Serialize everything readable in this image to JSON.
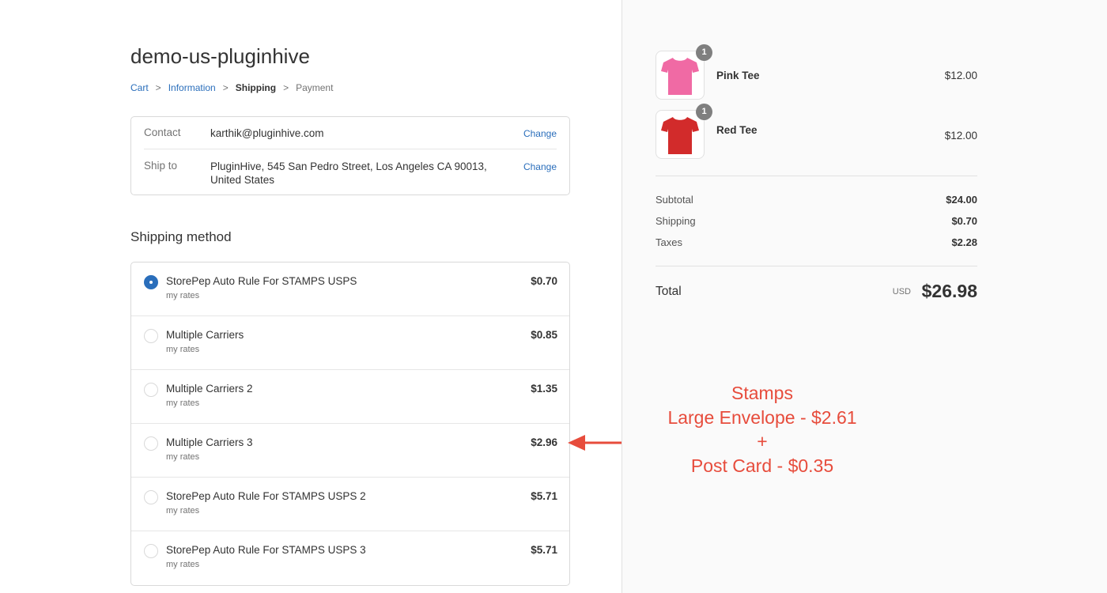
{
  "store": {
    "name": "demo-us-pluginhive"
  },
  "breadcrumb": {
    "items": [
      "Cart",
      "Information",
      "Shipping",
      "Payment"
    ],
    "separator": ">"
  },
  "review": {
    "contact": {
      "label": "Contact",
      "value": "karthik@pluginhive.com",
      "action": "Change"
    },
    "ship_to": {
      "label": "Ship to",
      "value": "PluginHive, 545 San Pedro Street, Los Angeles CA 90013, United States",
      "action": "Change"
    }
  },
  "shipping_method": {
    "title": "Shipping method",
    "options": [
      {
        "name": "StorePep Auto Rule For STAMPS USPS",
        "sub": "my rates",
        "price": "$0.70",
        "selected": true
      },
      {
        "name": "Multiple Carriers",
        "sub": "my rates",
        "price": "$0.85",
        "selected": false
      },
      {
        "name": "Multiple Carriers 2",
        "sub": "my rates",
        "price": "$1.35",
        "selected": false
      },
      {
        "name": "Multiple Carriers 3",
        "sub": "my rates",
        "price": "$2.96",
        "selected": false
      },
      {
        "name": "StorePep Auto Rule For STAMPS USPS 2",
        "sub": "my rates",
        "price": "$5.71",
        "selected": false
      },
      {
        "name": "StorePep Auto Rule For STAMPS USPS 3",
        "sub": "my rates",
        "price": "$5.71",
        "selected": false
      }
    ]
  },
  "order": {
    "items": [
      {
        "name": "Pink Tee",
        "price": "$12.00",
        "quantity": "1",
        "color": "#f06aa4",
        "icon": "tshirt-icon"
      },
      {
        "name": "Red Tee",
        "price": "$12.00",
        "quantity": "1",
        "color": "#d22b2b",
        "icon": "tshirt-icon"
      }
    ],
    "subtotal": {
      "label": "Subtotal",
      "value": "$24.00"
    },
    "shipping": {
      "label": "Shipping",
      "value": "$0.70"
    },
    "taxes": {
      "label": "Taxes",
      "value": "$2.28"
    },
    "total": {
      "label": "Total",
      "currency": "USD",
      "value": "$26.98"
    }
  },
  "annotation": {
    "lines": [
      "Stamps",
      "Large Envelope - $2.61",
      "+",
      "Post Card - $0.35"
    ],
    "color": "#e74c3c",
    "points_to_option": "Multiple Carriers 3"
  },
  "colors": {
    "accent": "#2a6ebb",
    "annotation": "#e74c3c",
    "sidebar_bg": "#fafafa"
  }
}
